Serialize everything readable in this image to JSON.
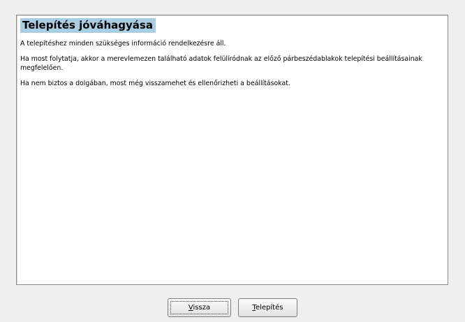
{
  "dialog": {
    "heading": "Telepítés jóváhagyása",
    "paragraphs": [
      "A telepítéshez minden szükséges információ rendelkezésre áll.",
      "Ha most folytatja, akkor a merevlemezen található adatok felülíródnak az előző párbeszédablakok telepítési beállításainak megfelelően.",
      "Ha nem biztos a dolgában, most még visszamehet és ellenőrizheti a beállításokat."
    ]
  },
  "buttons": {
    "back": {
      "mnemonic": "V",
      "rest": "issza"
    },
    "install": {
      "mnemonic": "T",
      "rest": "elepítés"
    }
  }
}
